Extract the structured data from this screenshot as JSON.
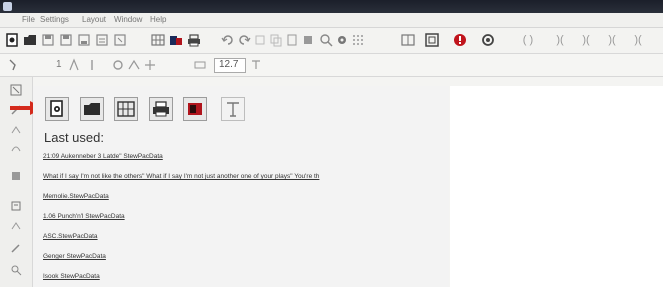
{
  "window": {
    "title": ""
  },
  "menubar": {
    "items": [
      "File",
      "Settings",
      "Layout",
      "Window",
      "Help"
    ]
  },
  "toolbar2": {
    "value1": "1",
    "value2": "12.7"
  },
  "startpanel": {
    "last_used_label": "Last used:",
    "recent_files": [
      "21:09 Aukenneber 3 Latde\" StewPacData",
      "What if I say I'm not like the others\" What if I say I'm not just another one of your plays\" You're th",
      "Memolie.StewPacData",
      "1.06 Punch'n'l StewPacData",
      "ASC.StewPacData",
      "Genger StewPacData",
      "Isook StewPacData"
    ]
  },
  "colors": {
    "arrow": "#d42a1c",
    "titlebar": "#1b1f2a",
    "accent_red": "#c0141c"
  }
}
